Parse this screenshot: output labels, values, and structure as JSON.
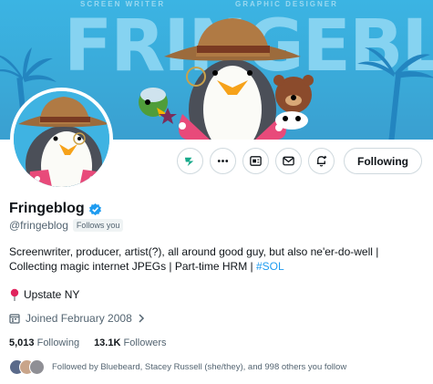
{
  "banner": {
    "small_text_left": "SCREEN WRITER",
    "small_text_right": "GRAPHIC DESIGNER",
    "big_text": "FRINGEBLOG"
  },
  "actions": {
    "following_label": "Following"
  },
  "profile": {
    "display_name": "Fringeblog",
    "handle": "@fringeblog",
    "follows_you": "Follows you",
    "bio_line1": "Screenwriter, producer, artist(?), all around good guy, but also ne'er-do-well |",
    "bio_line2_text": "Collecting magic internet JPEGs | Part-time HRM | ",
    "bio_hashtag": "#SOL",
    "location": "Upstate NY",
    "joined": "Joined February 2008",
    "following_count": "5,013",
    "following_label": "Following",
    "followers_count": "13.1K",
    "followers_label": "Followers",
    "followed_by": "Followed by Bluebeard, Stacey Russell (she/they), and 998 others you follow"
  },
  "colors": {
    "accent": "#1d9bf0",
    "banner": "#3bb4e3",
    "muted_text": "#536471"
  }
}
